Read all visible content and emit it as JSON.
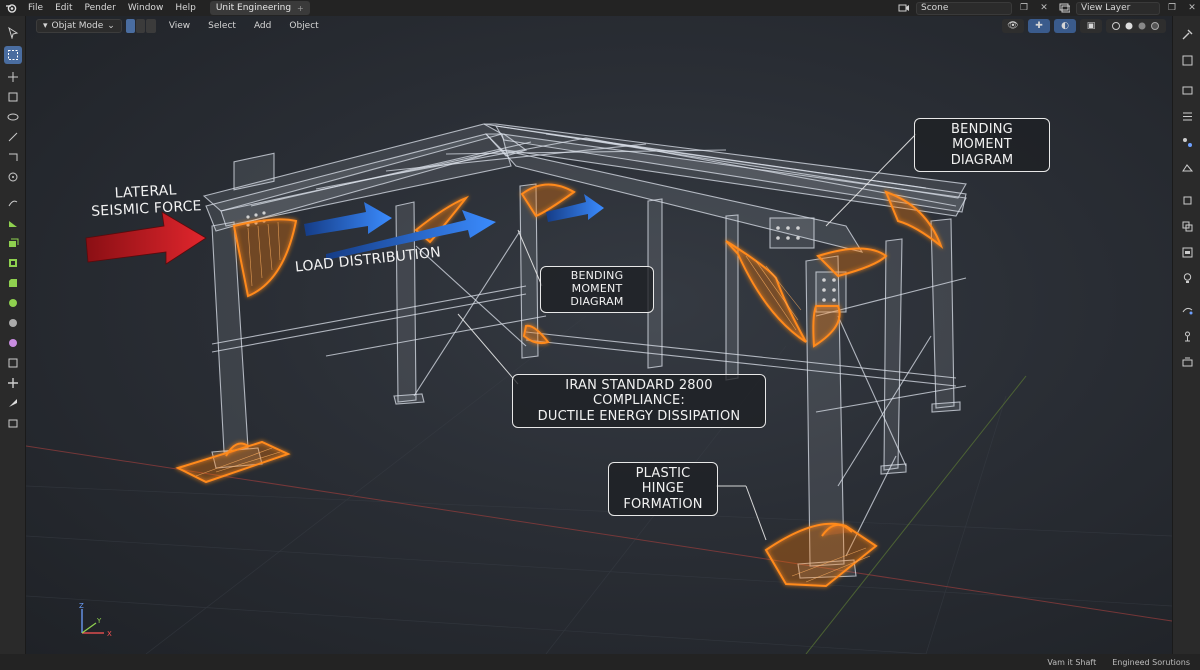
{
  "topbar": {
    "menus": [
      "File",
      "Edit",
      "Pender",
      "Window",
      "Help"
    ],
    "active_tab": "Unit Engineering",
    "scene_label": "Scone",
    "view_layer": "View Layer"
  },
  "viewport_header": {
    "mode": "Objat Mode",
    "menus": [
      "View",
      "Select",
      "Add",
      "Object"
    ]
  },
  "annotations": {
    "lateral": "LATERAL\nSEISMIC FORCE",
    "load": "LOAD DISTRIBUTION",
    "bending_top": "BENDING MOMENT\nDIAGRAM",
    "bending_mid": "BENDING MOMENT\nDIAGRAM",
    "iran": "IRAN STANDARD 2800 COMPLIANCE:\nDUCTILE ENERGY DISSIPATION",
    "hinge": "PLASTIC HINGE\nFORMATION"
  },
  "status": {
    "left": "Vam it Shaft",
    "right": "Engineed Sorutions"
  },
  "colors": {
    "accent": "#4a6da0",
    "force_red": "#d8232a",
    "force_blue": "#2f7cf0",
    "glow_orange": "#ff8a1a"
  }
}
